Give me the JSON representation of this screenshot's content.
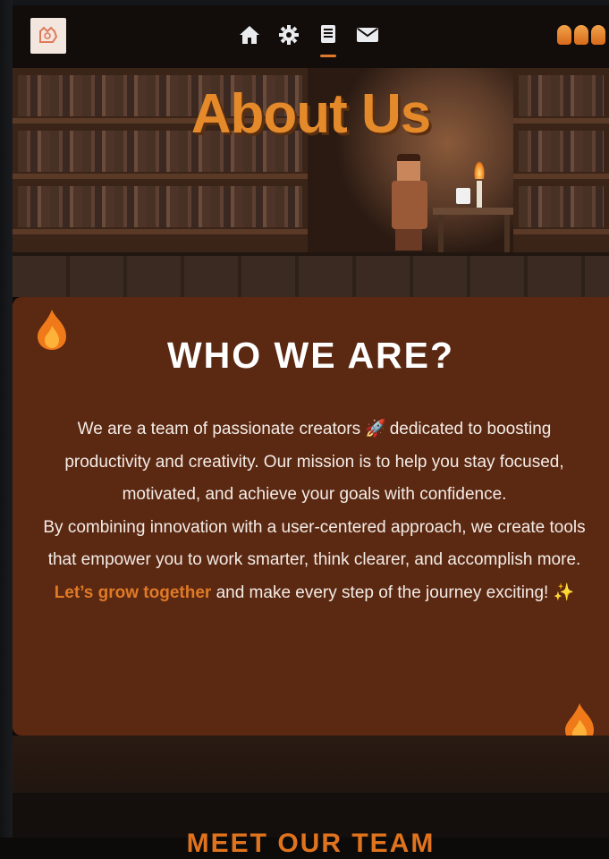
{
  "nav": {
    "logo": "logo-icon",
    "items": [
      {
        "name": "home",
        "icon": "home-icon"
      },
      {
        "name": "settings",
        "icon": "gear-icon"
      },
      {
        "name": "about",
        "icon": "book-icon",
        "active": true
      },
      {
        "name": "contact",
        "icon": "mail-icon"
      }
    ],
    "streak_icon": "flame-streak-icon"
  },
  "hero": {
    "title": "About Us"
  },
  "about": {
    "heading": "WHO WE ARE?",
    "p1_before": "We are a team of passionate creators ",
    "p1_emoji": "🚀",
    "p1_after": " dedicated to boosting productivity and creativity. Our mission is to help you stay focused, motivated, and achieve your goals with confidence.",
    "p2": "By combining innovation with a user-centered approach, we create tools that empower you to work smarter, think clearer, and accomplish more.",
    "p3_highlight": "Let’s grow together",
    "p3_rest": " and make every step of the journey exciting! ",
    "p3_emoji": "✨"
  },
  "team": {
    "heading": "MEET OUR TEAM"
  },
  "colors": {
    "accent": "#e07a26",
    "card_bg": "#5b2812",
    "nav_bg": "#120d0b"
  }
}
